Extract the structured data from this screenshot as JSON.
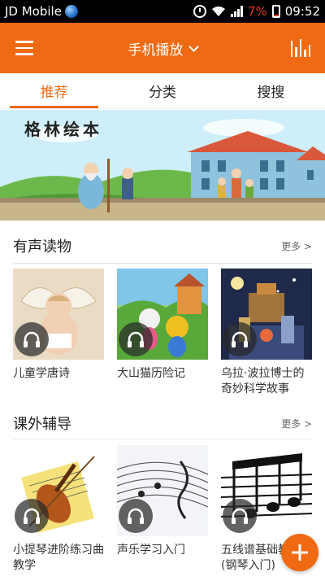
{
  "status_bar": {
    "carrier": "JD Mobile",
    "battery_percent": "7%",
    "time": "09:52"
  },
  "app_bar": {
    "title": "手机播放"
  },
  "tabs": [
    {
      "label": "推荐",
      "active": true
    },
    {
      "label": "分类",
      "active": false
    },
    {
      "label": "搜搜",
      "active": false
    }
  ],
  "banner": {
    "title": "格林绘本"
  },
  "sections": [
    {
      "title": "有声读物",
      "more": "更多 >",
      "items": [
        {
          "label": "儿童学唐诗"
        },
        {
          "label": "大山猫历险记"
        },
        {
          "label": "乌拉·波拉博士的奇妙科学故事"
        }
      ]
    },
    {
      "title": "课外辅导",
      "more": "更多 >",
      "items": [
        {
          "label": "小提琴进阶练习曲教学"
        },
        {
          "label": "声乐学习入门"
        },
        {
          "label": "五线谱基础教程(钢琴入门)"
        }
      ]
    }
  ],
  "colors": {
    "accent": "#ef6a12",
    "status_bar": "#000000",
    "battery_low": "#e23a2b"
  },
  "icons": {
    "menu": "hamburger-icon",
    "dropdown": "chevron-down-icon",
    "equalizer": "equalizer-icon",
    "play_badge": "headphones-icon",
    "fab": "plus-icon"
  }
}
